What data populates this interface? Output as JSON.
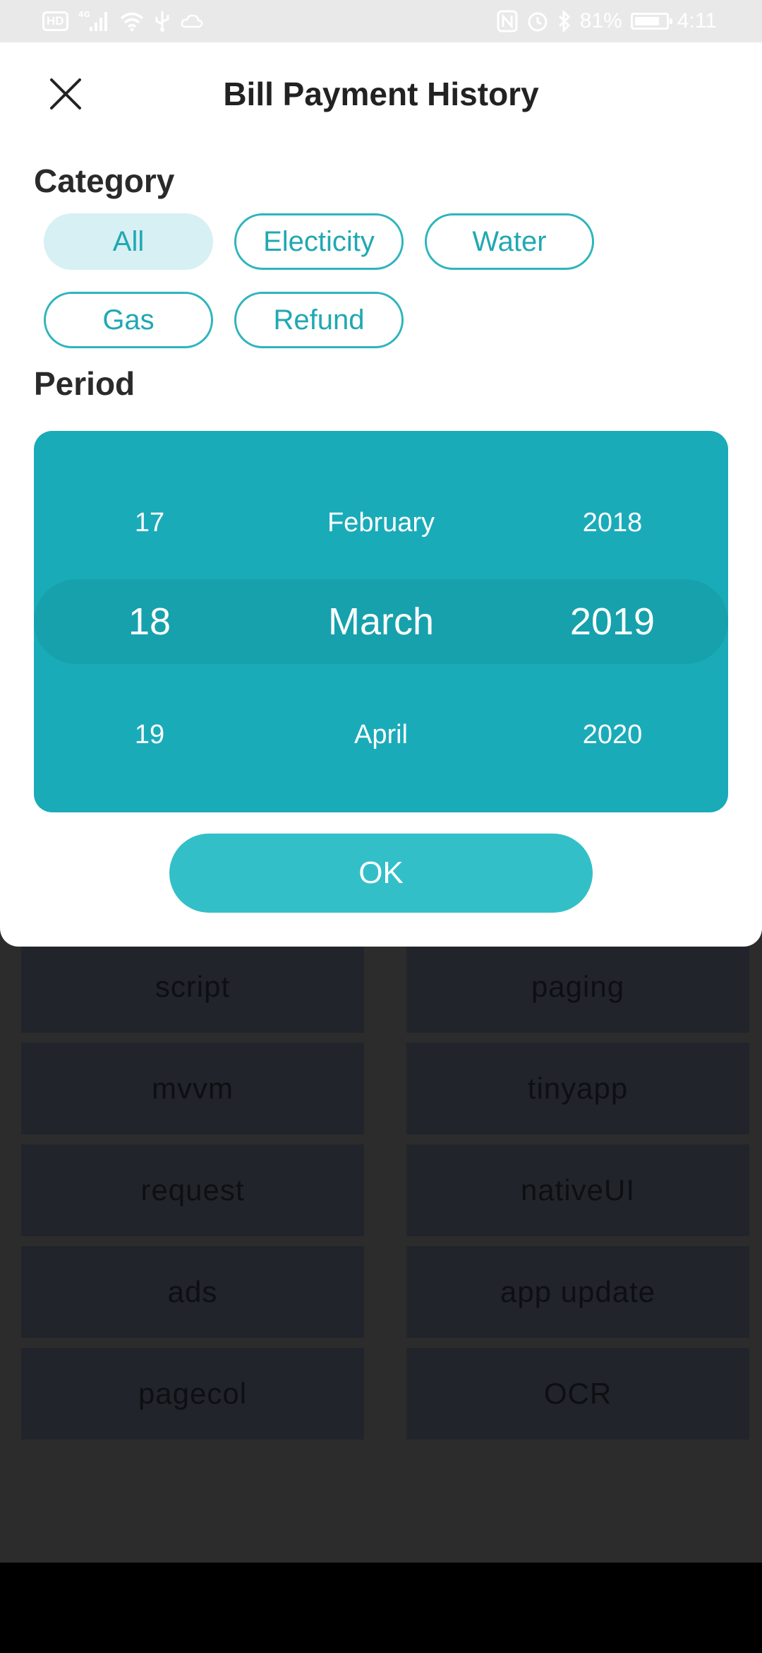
{
  "status_bar": {
    "badge": "HD",
    "network": "4G",
    "battery_percent": "81%",
    "battery_level": 0.81,
    "time": "4:11",
    "icons": [
      "signal-icon",
      "wifi-icon",
      "usb-icon",
      "cloud-icon",
      "nfc-icon",
      "alarm-icon",
      "bluetooth-icon",
      "battery-icon"
    ]
  },
  "dialog": {
    "title": "Bill Payment History",
    "close_icon": "close-icon",
    "category_label": "Category",
    "period_label": "Period",
    "categories": [
      {
        "label": "All",
        "selected": true
      },
      {
        "label": "Electicity",
        "selected": false
      },
      {
        "label": "Water",
        "selected": false
      },
      {
        "label": "Gas",
        "selected": false
      },
      {
        "label": "Refund",
        "selected": false
      }
    ],
    "picker": {
      "day": {
        "prev": "17",
        "current": "18",
        "next": "19"
      },
      "month": {
        "prev": "February",
        "current": "March",
        "next": "April"
      },
      "year": {
        "prev": "2018",
        "current": "2019",
        "next": "2020"
      }
    },
    "ok_label": "OK"
  },
  "background_grid": [
    "script",
    "paging",
    "mvvm",
    "tinyapp",
    "request",
    "nativeUI",
    "ads",
    "app update",
    "pagecol",
    "OCR"
  ],
  "colors": {
    "accent": "#1aabb9",
    "accent_dark": "#17a1ad",
    "button": "#33bfc8",
    "chip_text": "#20a8b3",
    "chip_selected_bg": "#d6f0f3"
  }
}
